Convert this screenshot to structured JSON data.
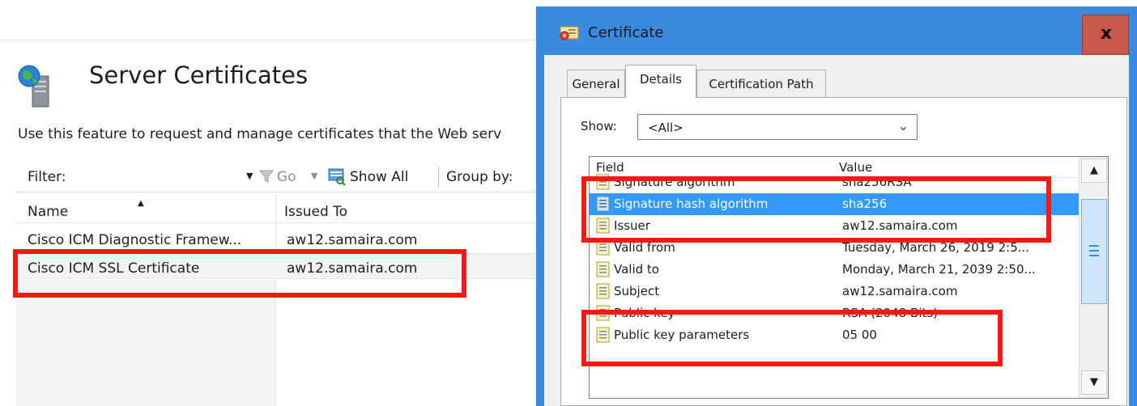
{
  "iis": {
    "title": "Server Certificates",
    "description": "Use this feature to request and manage certificates that the Web serv",
    "toolbar": {
      "filter_label": "Filter:",
      "go_label": "Go",
      "show_all_label": "Show All",
      "group_by_label": "Group by:"
    },
    "columns": {
      "name": "Name",
      "issued_to": "Issued To"
    },
    "rows": [
      {
        "name": "Cisco ICM Diagnostic Framew...",
        "issued_to": "aw12.samaira.com"
      },
      {
        "name": "Cisco ICM SSL Certificate",
        "issued_to": "aw12.samaira.com"
      }
    ],
    "icons": {
      "feature": "server-certificates-icon",
      "filter": "funnel-icon",
      "show_all": "show-all-icon",
      "sort": "sort-ascending-icon"
    }
  },
  "dialog": {
    "title": "Certificate",
    "close_glyph": "x",
    "tabs": [
      {
        "label": "General",
        "selected": false
      },
      {
        "label": "Details",
        "selected": true
      },
      {
        "label": "Certification Path",
        "selected": false
      }
    ],
    "show_label": "Show:",
    "show_value": "<All>",
    "field_list": {
      "header_field": "Field",
      "header_value": "Value",
      "rows": [
        {
          "field": "Signature algorithm",
          "value": "sha256RSA",
          "selected": false
        },
        {
          "field": "Signature hash algorithm",
          "value": "sha256",
          "selected": true
        },
        {
          "field": "Issuer",
          "value": "aw12.samaira.com",
          "selected": false
        },
        {
          "field": "Valid from",
          "value": "Tuesday, March 26, 2019 2:5...",
          "selected": false
        },
        {
          "field": "Valid to",
          "value": "Monday, March 21, 2039 2:50...",
          "selected": false
        },
        {
          "field": "Subject",
          "value": "aw12.samaira.com",
          "selected": false
        },
        {
          "field": "Public key",
          "value": "RSA (2048 Bits)",
          "selected": false
        },
        {
          "field": "Public key parameters",
          "value": "05 00",
          "selected": false
        }
      ]
    }
  },
  "colors": {
    "title_bar": "#3b8ae0",
    "close_button": "#c8574c",
    "selection": "#3399ff",
    "annotation": "#ee1c14"
  }
}
